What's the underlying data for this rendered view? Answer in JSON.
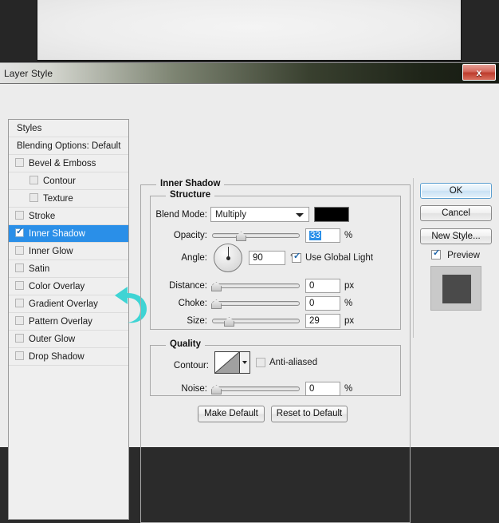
{
  "window": {
    "title": "Layer Style",
    "close_label": "x"
  },
  "styles_panel": {
    "items": [
      {
        "label": "Styles",
        "type": "header",
        "checked": false,
        "selected": false,
        "sub": false
      },
      {
        "label": "Blending Options: Default",
        "type": "header",
        "checked": false,
        "selected": false,
        "sub": false
      },
      {
        "label": "Bevel & Emboss",
        "type": "item",
        "checked": false,
        "selected": false,
        "sub": false
      },
      {
        "label": "Contour",
        "type": "item",
        "checked": false,
        "selected": false,
        "sub": true
      },
      {
        "label": "Texture",
        "type": "item",
        "checked": false,
        "selected": false,
        "sub": true
      },
      {
        "label": "Stroke",
        "type": "item",
        "checked": false,
        "selected": false,
        "sub": false
      },
      {
        "label": "Inner Shadow",
        "type": "item",
        "checked": true,
        "selected": true,
        "sub": false
      },
      {
        "label": "Inner Glow",
        "type": "item",
        "checked": false,
        "selected": false,
        "sub": false
      },
      {
        "label": "Satin",
        "type": "item",
        "checked": false,
        "selected": false,
        "sub": false
      },
      {
        "label": "Color Overlay",
        "type": "item",
        "checked": false,
        "selected": false,
        "sub": false
      },
      {
        "label": "Gradient Overlay",
        "type": "item",
        "checked": false,
        "selected": false,
        "sub": false
      },
      {
        "label": "Pattern Overlay",
        "type": "item",
        "checked": false,
        "selected": false,
        "sub": false
      },
      {
        "label": "Outer Glow",
        "type": "item",
        "checked": false,
        "selected": false,
        "sub": false
      },
      {
        "label": "Drop Shadow",
        "type": "item",
        "checked": false,
        "selected": false,
        "sub": false
      }
    ]
  },
  "panel": {
    "group_title": "Inner Shadow",
    "structure": {
      "legend": "Structure",
      "blend_mode_label": "Blend Mode:",
      "blend_mode_value": "Multiply",
      "shadow_color": "#000000",
      "opacity_label": "Opacity:",
      "opacity_value": "33",
      "opacity_unit": "%",
      "angle_label": "Angle:",
      "angle_value": "90",
      "angle_unit": "°",
      "use_global_light_label": "Use Global Light",
      "use_global_light_checked": true,
      "distance_label": "Distance:",
      "distance_value": "0",
      "distance_unit": "px",
      "choke_label": "Choke:",
      "choke_value": "0",
      "choke_unit": "%",
      "size_label": "Size:",
      "size_value": "29",
      "size_unit": "px"
    },
    "quality": {
      "legend": "Quality",
      "contour_label": "Contour:",
      "anti_aliased_label": "Anti-aliased",
      "anti_aliased_checked": false,
      "noise_label": "Noise:",
      "noise_value": "0",
      "noise_unit": "%"
    },
    "make_default_label": "Make Default",
    "reset_default_label": "Reset to Default"
  },
  "actions": {
    "ok_label": "OK",
    "cancel_label": "Cancel",
    "new_style_label": "New Style...",
    "preview_label": "Preview",
    "preview_checked": true
  },
  "chart_data": null
}
